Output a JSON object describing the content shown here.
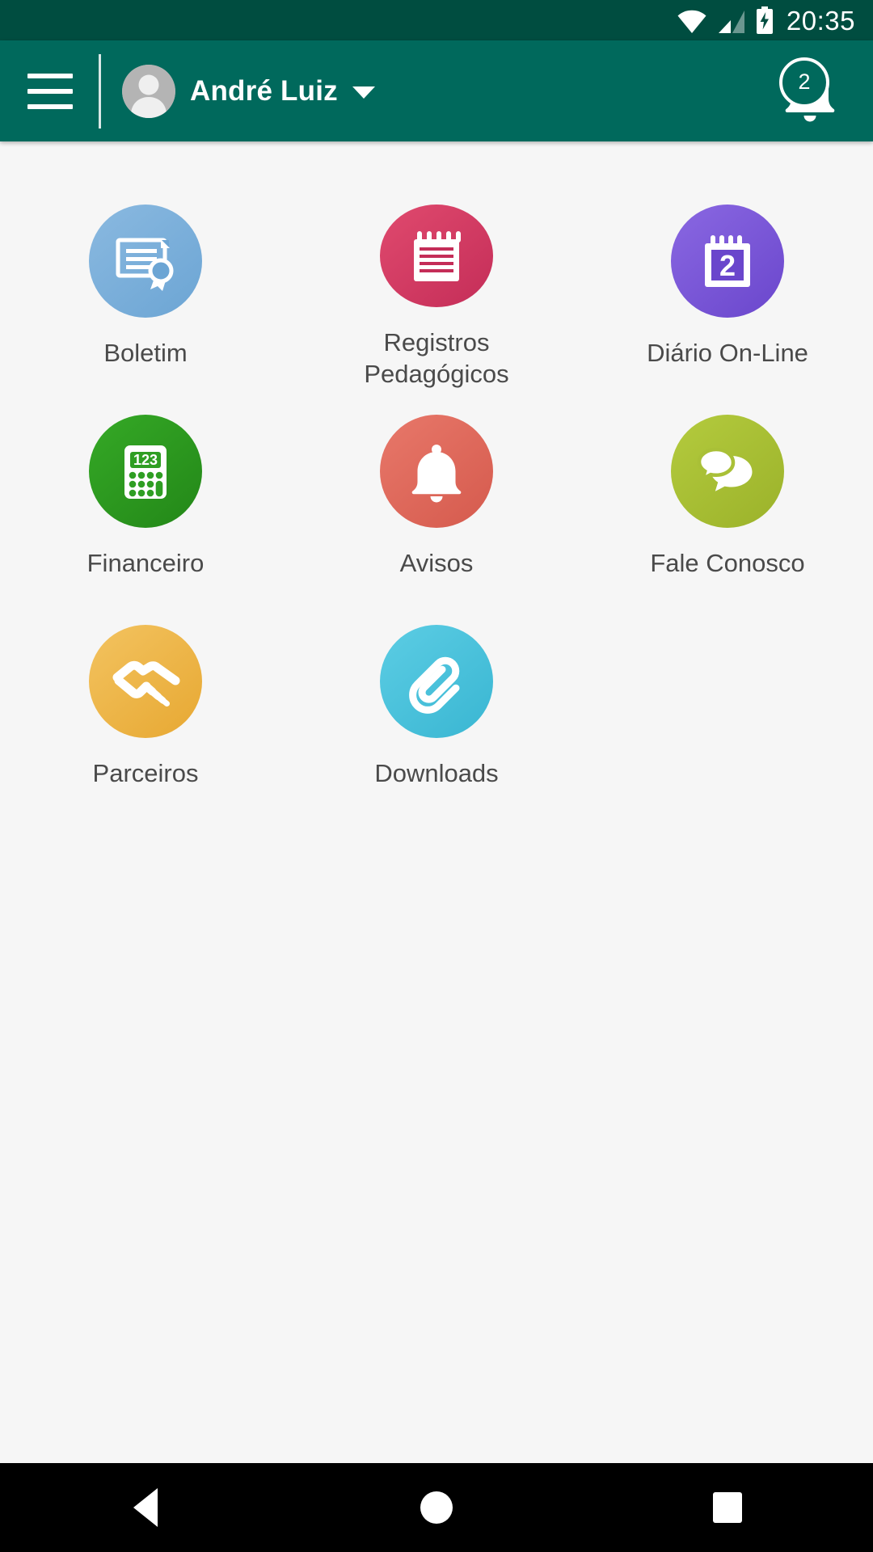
{
  "status_bar": {
    "time": "20:35",
    "icons": [
      "wifi-icon",
      "cellular-signal-icon",
      "battery-charging-icon"
    ],
    "background_color": "#004d40"
  },
  "app_bar": {
    "background_color": "#00695c",
    "menu_icon": "hamburger-menu-icon",
    "avatar_icon": "user-avatar-placeholder-icon",
    "user_name": "André Luiz",
    "dropdown_icon": "chevron-down-icon",
    "notification": {
      "icon": "bell-icon",
      "badge_count": "2"
    }
  },
  "main": {
    "background_color": "#f6f6f6",
    "tiles": [
      {
        "label": "Boletim",
        "icon": "certificate-icon",
        "color": "#7fb2dc",
        "color2": "#6ea7d6"
      },
      {
        "label": "Registros\nPedagógicos",
        "icon": "notepad-icon",
        "color": "#da3c63",
        "color2": "#c9315a"
      },
      {
        "label": "Diário On-Line",
        "icon": "calendar-icon",
        "color": "#7b5cd6",
        "color2": "#6f4fd0",
        "calendar_day": "2"
      },
      {
        "label": "Financeiro",
        "icon": "calculator-icon",
        "color": "#2f9e23",
        "color2": "#2b8f20",
        "display_text": "123"
      },
      {
        "label": "Avisos",
        "icon": "bell-icon",
        "color": "#e0685c",
        "color2": "#d85b4f"
      },
      {
        "label": "Fale Conosco",
        "icon": "chat-bubbles-icon",
        "color": "#a9c037",
        "color2": "#9fb62e"
      },
      {
        "label": "Parceiros",
        "icon": "handshake-icon",
        "color": "#efb94e",
        "color2": "#e9ae3c"
      },
      {
        "label": "Downloads",
        "icon": "paperclip-icon",
        "color": "#4ec3dd",
        "color2": "#43bad6"
      }
    ]
  },
  "nav_bar": {
    "background_color": "#000000",
    "buttons": [
      {
        "name": "back-button",
        "icon": "triangle-back-icon"
      },
      {
        "name": "home-button",
        "icon": "circle-home-icon"
      },
      {
        "name": "recents-button",
        "icon": "square-recents-icon"
      }
    ]
  }
}
